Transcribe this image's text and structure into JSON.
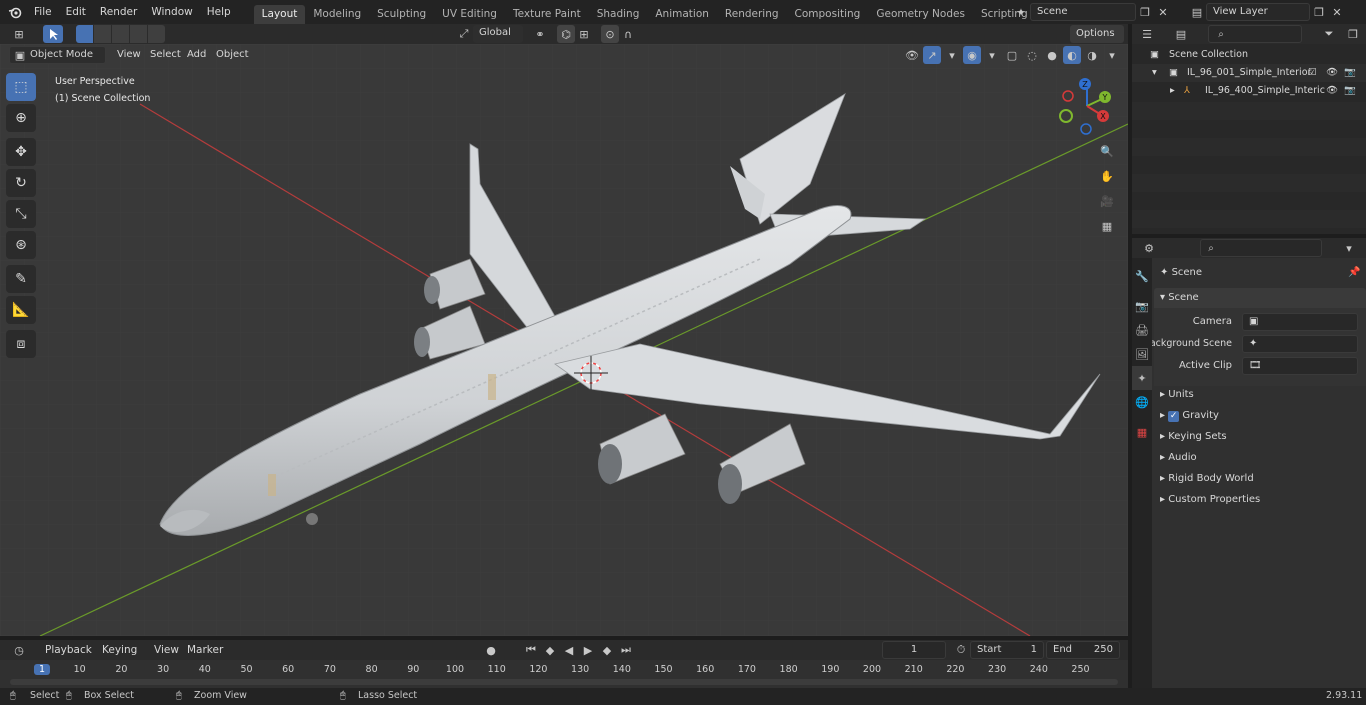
{
  "topbar": {
    "menus": [
      "File",
      "Edit",
      "Render",
      "Window",
      "Help"
    ],
    "workspaces": [
      "Layout",
      "Modeling",
      "Sculpting",
      "UV Editing",
      "Texture Paint",
      "Shading",
      "Animation",
      "Rendering",
      "Compositing",
      "Geometry Nodes",
      "Scripting"
    ],
    "active_workspace": "Layout",
    "scene_name": "Scene",
    "view_layer": "View Layer"
  },
  "viewport": {
    "mode": "Object Mode",
    "menus": [
      "View",
      "Select",
      "Add",
      "Object"
    ],
    "transform_orientation": "Global",
    "options_label": "Options",
    "overlay_title": "User Perspective",
    "overlay_subtitle": "(1) Scene Collection",
    "gizmo_labels": {
      "z": "Z",
      "y": "Y",
      "x": "X"
    }
  },
  "outliner": {
    "root": "Scene Collection",
    "items": [
      {
        "label": "IL_96_001_Simple_Interior"
      },
      {
        "label": "IL_96_400_Simple_Interic"
      }
    ]
  },
  "properties": {
    "header": "Scene",
    "panel_title": "Scene",
    "fields": [
      {
        "label": "Camera"
      },
      {
        "label": "Background Scene"
      },
      {
        "label": "Active Clip"
      }
    ],
    "sections": [
      "Units",
      "Gravity",
      "Keying Sets",
      "Audio",
      "Rigid Body World",
      "Custom Properties"
    ]
  },
  "timeline": {
    "menus": [
      "Playback",
      "Keying",
      "View",
      "Marker"
    ],
    "current_frame": "1",
    "start_label": "Start",
    "start_value": "1",
    "end_label": "End",
    "end_value": "250",
    "ruler": [
      "1",
      "10",
      "20",
      "30",
      "40",
      "50",
      "60",
      "70",
      "80",
      "90",
      "100",
      "110",
      "120",
      "130",
      "140",
      "150",
      "160",
      "170",
      "180",
      "190",
      "200",
      "210",
      "220",
      "230",
      "240",
      "250"
    ]
  },
  "statusbar": {
    "hints": [
      "Select",
      "Box Select",
      "Zoom View",
      "Lasso Select"
    ],
    "version": "2.93.11"
  },
  "colors": {
    "accent": "#4772b3",
    "viewport_bg": "#393939",
    "axis_x": "#b43c3c",
    "axis_y": "#6a9a2a"
  }
}
